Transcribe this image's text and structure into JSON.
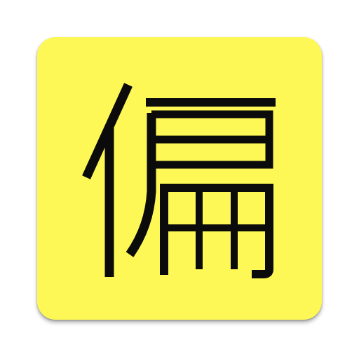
{
  "app_icon": {
    "glyph": "偏",
    "background_color": "#fdf855",
    "glyph_color": "#0b0b0b",
    "icon": "kanji-character-icon"
  }
}
